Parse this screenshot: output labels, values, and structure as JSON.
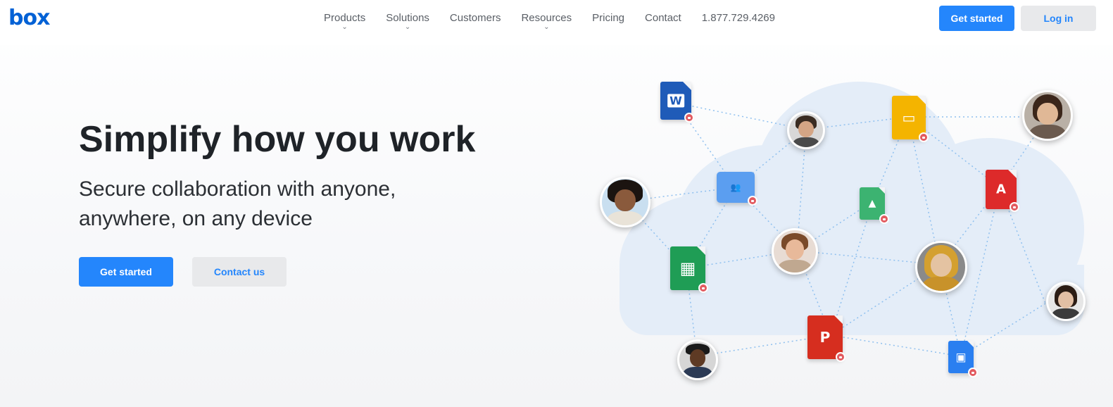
{
  "brand": {
    "logo_text": "box",
    "color": "#0061d5"
  },
  "nav": {
    "items": [
      {
        "label": "Products",
        "has_dropdown": true
      },
      {
        "label": "Solutions",
        "has_dropdown": true
      },
      {
        "label": "Customers",
        "has_dropdown": false
      },
      {
        "label": "Resources",
        "has_dropdown": true
      },
      {
        "label": "Pricing",
        "has_dropdown": false
      },
      {
        "label": "Contact",
        "has_dropdown": false
      },
      {
        "label": "1.877.729.4269",
        "has_dropdown": false
      }
    ],
    "dropdown_glyph": "⌄"
  },
  "header_actions": {
    "get_started": "Get started",
    "log_in": "Log in"
  },
  "hero": {
    "title": "Simplify how you work",
    "subtitle_line1": "Secure collaboration with anyone,",
    "subtitle_line2": "anywhere, on any device",
    "primary_cta": "Get started",
    "secondary_cta": "Contact us"
  },
  "illustration": {
    "files": [
      {
        "name": "word-file-icon",
        "glyph": "W",
        "color": "#1f5bb8"
      },
      {
        "name": "slides-file-icon",
        "glyph": "▭",
        "color": "#f4b400"
      },
      {
        "name": "folder-icon",
        "glyph": "👥",
        "color": "#5b9ef0"
      },
      {
        "name": "image-file-icon",
        "glyph": "▲",
        "color": "#3cb371"
      },
      {
        "name": "pdf-file-icon",
        "glyph": "A",
        "color": "#dd2a2a"
      },
      {
        "name": "sheets-file-icon",
        "glyph": "▦",
        "color": "#1f9d55"
      },
      {
        "name": "powerpoint-file-icon",
        "glyph": "P",
        "color": "#d62e1f"
      },
      {
        "name": "keynote-file-icon",
        "glyph": "▣",
        "color": "#2a7ff0"
      }
    ],
    "lock_color": "#e25b60",
    "link_color": "#8fc0ef",
    "cloud_color": "#e4edf8"
  },
  "colors": {
    "accent": "#2486fc",
    "secondary_bg": "#e8e9eb"
  }
}
